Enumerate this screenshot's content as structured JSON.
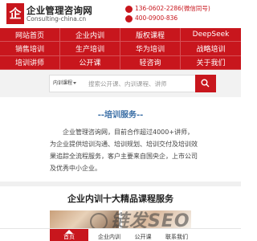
{
  "header": {
    "logo_mark": "企",
    "title": "企业管理咨询网",
    "subtitle": "Consulting-china.cn",
    "phone1": "136-0602-2286(微信同号)",
    "phone2": "400-0900-836"
  },
  "nav": {
    "items": [
      {
        "label": "网站首页"
      },
      {
        "label": "企业内训"
      },
      {
        "label": "版权课程"
      },
      {
        "label": "DeepSeek"
      },
      {
        "label": "销售培训"
      },
      {
        "label": "生产培训"
      },
      {
        "label": "华为培训"
      },
      {
        "label": "战略培训"
      },
      {
        "label": "培训讲师"
      },
      {
        "label": "公开课"
      },
      {
        "label": "轻咨询"
      },
      {
        "label": "关于我们"
      }
    ]
  },
  "search": {
    "category": "内训课程",
    "placeholder": "搜索公开课、内训课程、讲师"
  },
  "services": {
    "title": "--培训服务--",
    "body": "企业管理咨询网，目前合作超过4000+讲师，为企业提供培训沟通、培训规划、培训交付及培训效果追踪全流程服务，客户主要来自国央企，上市公司及优秀中小企业。"
  },
  "courses": {
    "title": "企业内训十大精品课程服务"
  },
  "bottom_bar": {
    "home": "首页",
    "inhouse": "企业内训",
    "public": "公开课",
    "contact": "联系我们"
  },
  "watermark": "链发SEO",
  "colors": {
    "brand_red": "#c8161d",
    "section_blue": "#3a6ea5"
  }
}
